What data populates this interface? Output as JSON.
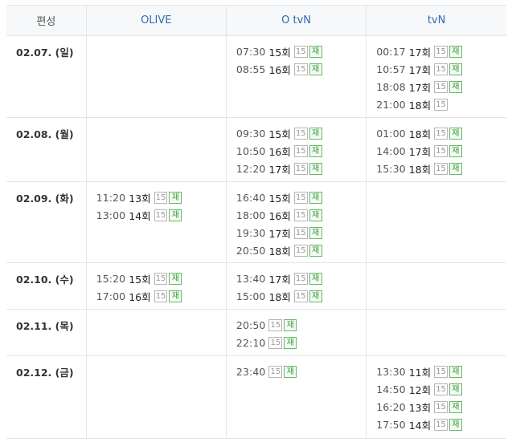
{
  "headers": {
    "date": "편성",
    "channels": [
      "OLIVE",
      "O tvN",
      "tvN"
    ]
  },
  "rows": [
    {
      "date": "02.07. (일)",
      "cells": [
        [],
        [
          {
            "time": "07:30",
            "ep": "15회",
            "age": "15",
            "re": "재"
          },
          {
            "time": "08:55",
            "ep": "16회",
            "age": "15",
            "re": "재"
          }
        ],
        [
          {
            "time": "00:17",
            "ep": "17회",
            "age": "15",
            "re": "재"
          },
          {
            "time": "10:57",
            "ep": "17회",
            "age": "15",
            "re": "재"
          },
          {
            "time": "18:08",
            "ep": "17회",
            "age": "15",
            "re": "재"
          },
          {
            "time": "21:00",
            "ep": "18회",
            "age": "15",
            "re": ""
          }
        ]
      ]
    },
    {
      "date": "02.08. (월)",
      "cells": [
        [],
        [
          {
            "time": "09:30",
            "ep": "15회",
            "age": "15",
            "re": "재"
          },
          {
            "time": "10:50",
            "ep": "16회",
            "age": "15",
            "re": "재"
          },
          {
            "time": "12:20",
            "ep": "17회",
            "age": "15",
            "re": "재"
          }
        ],
        [
          {
            "time": "01:00",
            "ep": "18회",
            "age": "15",
            "re": "재"
          },
          {
            "time": "14:00",
            "ep": "17회",
            "age": "15",
            "re": "재"
          },
          {
            "time": "15:30",
            "ep": "18회",
            "age": "15",
            "re": "재"
          }
        ]
      ]
    },
    {
      "date": "02.09. (화)",
      "cells": [
        [
          {
            "time": "11:20",
            "ep": "13회",
            "age": "15",
            "re": "재"
          },
          {
            "time": "13:00",
            "ep": "14회",
            "age": "15",
            "re": "재"
          }
        ],
        [
          {
            "time": "16:40",
            "ep": "15회",
            "age": "15",
            "re": "재"
          },
          {
            "time": "18:00",
            "ep": "16회",
            "age": "15",
            "re": "재"
          },
          {
            "time": "19:30",
            "ep": "17회",
            "age": "15",
            "re": "재"
          },
          {
            "time": "20:50",
            "ep": "18회",
            "age": "15",
            "re": "재"
          }
        ],
        []
      ]
    },
    {
      "date": "02.10. (수)",
      "cells": [
        [
          {
            "time": "15:20",
            "ep": "15회",
            "age": "15",
            "re": "재"
          },
          {
            "time": "17:00",
            "ep": "16회",
            "age": "15",
            "re": "재"
          }
        ],
        [
          {
            "time": "13:40",
            "ep": "17회",
            "age": "15",
            "re": "재"
          },
          {
            "time": "15:00",
            "ep": "18회",
            "age": "15",
            "re": "재"
          }
        ],
        []
      ]
    },
    {
      "date": "02.11. (목)",
      "cells": [
        [],
        [
          {
            "time": "20:50",
            "ep": "",
            "age": "15",
            "re": "재"
          },
          {
            "time": "22:10",
            "ep": "",
            "age": "15",
            "re": "재"
          }
        ],
        []
      ]
    },
    {
      "date": "02.12. (금)",
      "cells": [
        [],
        [
          {
            "time": "23:40",
            "ep": "",
            "age": "15",
            "re": "재"
          }
        ],
        [
          {
            "time": "13:30",
            "ep": "11회",
            "age": "15",
            "re": "재"
          },
          {
            "time": "14:50",
            "ep": "12회",
            "age": "15",
            "re": "재"
          },
          {
            "time": "16:20",
            "ep": "13회",
            "age": "15",
            "re": "재"
          },
          {
            "time": "17:50",
            "ep": "14회",
            "age": "15",
            "re": "재"
          }
        ]
      ]
    }
  ]
}
